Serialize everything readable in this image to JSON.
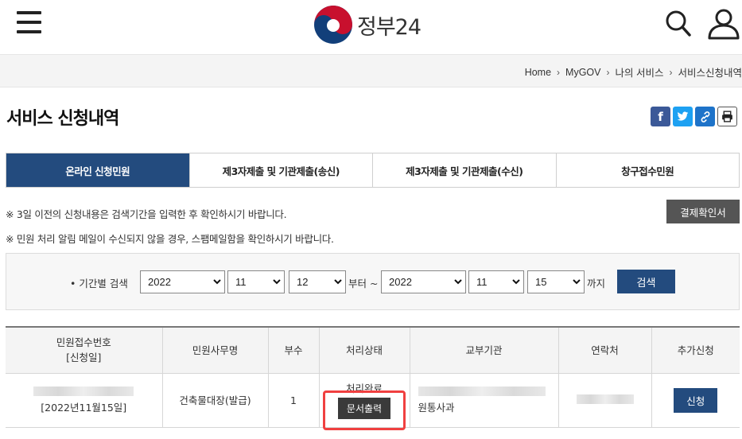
{
  "header": {
    "logo_text": "정부24",
    "logo_colors": {
      "red": "#c8102e",
      "blue": "#123f7a"
    }
  },
  "breadcrumb": [
    "Home",
    "MyGOV",
    "나의 서비스",
    "서비스신청내역"
  ],
  "page": {
    "title": "서비스 신청내역"
  },
  "share": {
    "facebook": "f",
    "twitter": "t",
    "link": "link-icon",
    "print": "print-icon"
  },
  "tabs": [
    {
      "label": "온라인 신청민원",
      "active": true
    },
    {
      "label": "제3자제출 및 기관제출(송신)",
      "active": false
    },
    {
      "label": "제3자제출 및 기관제출(수신)",
      "active": false
    },
    {
      "label": "창구접수민원",
      "active": false
    }
  ],
  "notices": {
    "line1": "※ 3일 이전의 신청내용은 검색기간을 입력한 후 확인하시기 바랍니다.",
    "line2": "※ 민원 처리 알림 메일이 수신되지 않을 경우, 스팸메일함을 확인하시기 바랍니다."
  },
  "pay_button": "결제확인서",
  "search": {
    "label": "• 기간별 검색",
    "from_year": "2022",
    "from_month": "11",
    "from_day": "12",
    "from_word": "부터 ~",
    "to_year": "2022",
    "to_month": "11",
    "to_day": "15",
    "to_word": "까지",
    "button": "검색"
  },
  "table": {
    "headers": {
      "receipt_line1": "민원접수번호",
      "receipt_line2": "[신청일]",
      "service": "민원사무명",
      "copies": "부수",
      "status": "처리상태",
      "agency": "교부기관",
      "contact": "연락처",
      "extra": "추가신청"
    },
    "rows": [
      {
        "date": "[2022년11월15일]",
        "service": "건축물대장(발급)",
        "copies": "1",
        "status": "처리완료",
        "doc_button": "문서출력",
        "agency": "원통사과",
        "apply_button": "신청"
      }
    ]
  },
  "colors": {
    "primary": "#234b7e",
    "highlight": "#f04040",
    "dark_button": "#3a3a3a"
  }
}
